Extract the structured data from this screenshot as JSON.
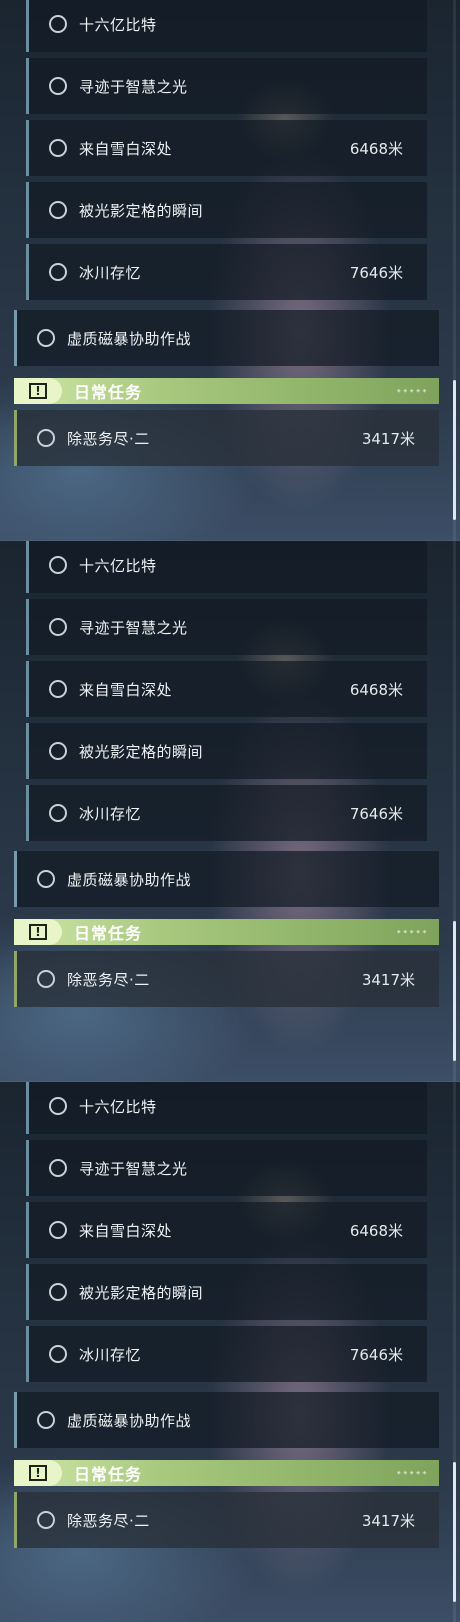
{
  "sub_quests": [
    {
      "label": "十六亿比特",
      "distance": ""
    },
    {
      "label": "寻迹于智慧之光",
      "distance": ""
    },
    {
      "label": "来自雪白深处",
      "distance": "6468米"
    },
    {
      "label": "被光影定格的瞬间",
      "distance": ""
    },
    {
      "label": "冰川存忆",
      "distance": "7646米"
    }
  ],
  "main_quest": {
    "label": "虚质磁暴协助作战"
  },
  "daily": {
    "title": "日常任务",
    "icon": "exclamation-icon",
    "quest": {
      "label": "除恶务尽·二",
      "distance": "3417米"
    }
  },
  "colors": {
    "daily_accent": "#a8c87e",
    "row_border": "#6a8fa0"
  }
}
